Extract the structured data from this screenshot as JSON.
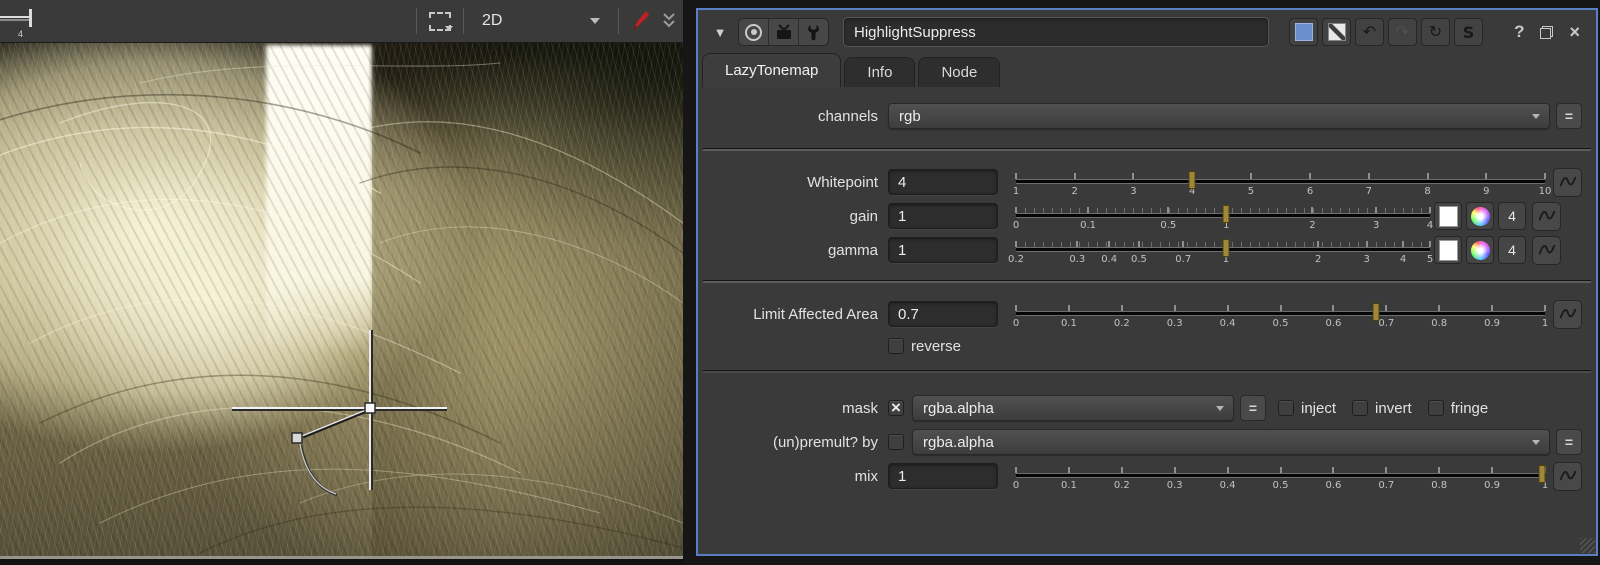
{
  "viewer": {
    "gain_indicator": "4",
    "view_mode": "2D"
  },
  "panel": {
    "title": "HighlightSuppress",
    "header": {
      "dropdown_glyph": "▼",
      "undo_glyph": "↶",
      "redo_glyph": "↷",
      "revert_glyph": "↻",
      "script_glyph": "S",
      "help_glyph": "?",
      "close_glyph": "×"
    },
    "tabs": [
      {
        "label": "LazyTonemap",
        "active": true
      },
      {
        "label": "Info",
        "active": false
      },
      {
        "label": "Node",
        "active": false
      }
    ],
    "rows": {
      "channels": {
        "label": "channels",
        "value": "rgb",
        "equals_label": "="
      },
      "whitepoint": {
        "label": "Whitepoint",
        "value": "4",
        "slider": {
          "handle_pct": 33.3,
          "minor": false,
          "ticks": [
            [
              "1",
              0
            ],
            [
              "2",
              11.1
            ],
            [
              "3",
              22.2
            ],
            [
              "4",
              33.3
            ],
            [
              "5",
              44.4
            ],
            [
              "6",
              55.6
            ],
            [
              "7",
              66.7
            ],
            [
              "8",
              77.8
            ],
            [
              "9",
              88.9
            ],
            [
              "10",
              100
            ]
          ]
        }
      },
      "gain": {
        "label": "gain",
        "value": "1",
        "channel_count": "4",
        "equals_label": "=",
        "slider": {
          "handle_pct": 50.8,
          "minor": true,
          "ticks": [
            [
              "0",
              0
            ],
            [
              "0.1",
              17.4
            ],
            [
              "0.5",
              36.8
            ],
            [
              "1",
              50.8
            ],
            [
              "2",
              71.6
            ],
            [
              "3",
              87
            ],
            [
              "4",
              100
            ]
          ]
        }
      },
      "gamma": {
        "label": "gamma",
        "value": "1",
        "channel_count": "4",
        "slider": {
          "handle_pct": 50.7,
          "minor": true,
          "ticks": [
            [
              "0.2",
              0
            ],
            [
              "0.3",
              14.8
            ],
            [
              "0.4",
              22.5
            ],
            [
              "0.5",
              29.7
            ],
            [
              "0.7",
              40.4
            ],
            [
              "1",
              50.7
            ],
            [
              "2",
              73
            ],
            [
              "3",
              84.7
            ],
            [
              "4",
              93.5
            ],
            [
              "5",
              100
            ]
          ]
        }
      },
      "limit": {
        "label": "Limit Affected Area",
        "value": "0.7",
        "slider": {
          "handle_pct": 68,
          "minor": false,
          "ticks": [
            [
              "0",
              0
            ],
            [
              "0.1",
              10
            ],
            [
              "0.2",
              20
            ],
            [
              "0.3",
              30
            ],
            [
              "0.4",
              40
            ],
            [
              "0.5",
              50
            ],
            [
              "0.6",
              60
            ],
            [
              "0.7",
              70
            ],
            [
              "0.8",
              80
            ],
            [
              "0.9",
              90
            ],
            [
              "1",
              100
            ]
          ]
        }
      },
      "reverse": {
        "label": "reverse",
        "checked": false
      },
      "mask": {
        "label": "mask",
        "checked": true,
        "check_glyph": "×",
        "value": "rgba.alpha",
        "equals_label": "=",
        "extras": [
          {
            "label": "inject",
            "checked": false
          },
          {
            "label": "invert",
            "checked": false
          },
          {
            "label": "fringe",
            "checked": false
          }
        ]
      },
      "unpremult": {
        "label": "(un)premult? by",
        "checked": false,
        "value": "rgba.alpha",
        "equals_label": "="
      },
      "mix": {
        "label": "mix",
        "value": "1",
        "slider": {
          "handle_pct": 99.5,
          "minor": false,
          "ticks": [
            [
              "0",
              0
            ],
            [
              "0.1",
              10
            ],
            [
              "0.2",
              20
            ],
            [
              "0.3",
              30
            ],
            [
              "0.4",
              40
            ],
            [
              "0.5",
              50
            ],
            [
              "0.6",
              60
            ],
            [
              "0.7",
              70
            ],
            [
              "0.8",
              80
            ],
            [
              "0.9",
              90
            ],
            [
              "1",
              100
            ]
          ]
        }
      }
    },
    "colors": {
      "accent_border": "#5a7fc4",
      "slider_handle": "#a18738",
      "node_swatch": "#6b8ccd"
    }
  }
}
